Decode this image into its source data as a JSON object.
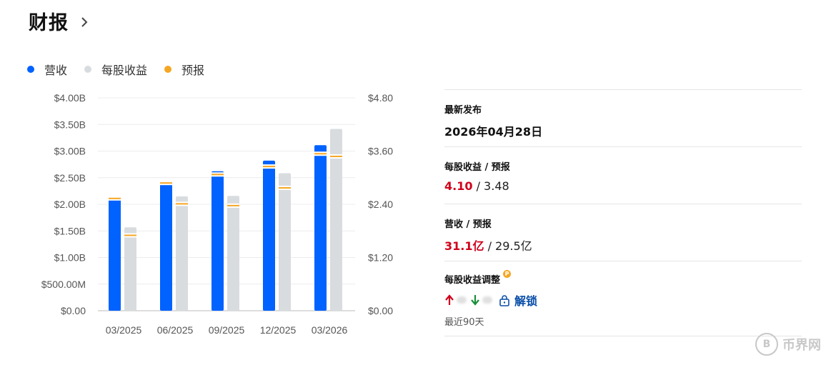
{
  "header": {
    "title": "财报"
  },
  "legend": [
    {
      "label": "营收",
      "color": "#0062ff"
    },
    {
      "label": "每股收益",
      "color": "#d9dcdf"
    },
    {
      "label": "预报",
      "color": "#f5a623"
    }
  ],
  "chart_data": {
    "type": "bar",
    "categories": [
      "03/2025",
      "06/2025",
      "09/2025",
      "12/2025",
      "03/2026"
    ],
    "left_axis": {
      "ticks": [
        "$4.00B",
        "$3.50B",
        "$3.00B",
        "$2.50B",
        "$2.00B",
        "$1.50B",
        "$1.00B",
        "$500.00M",
        "$0.00"
      ],
      "ylim": [
        0,
        4.0
      ],
      "unit": "B"
    },
    "right_axis": {
      "ticks": [
        "$4.80",
        "$3.60",
        "$2.40",
        "$1.20",
        "$0.00"
      ],
      "ylim": [
        0,
        4.8
      ]
    },
    "series": [
      {
        "name": "营收",
        "axis": "left",
        "color": "#0062ff",
        "values": [
          2.14,
          2.4,
          2.62,
          2.82,
          3.11
        ],
        "forecast": [
          2.11,
          2.4,
          2.56,
          2.71,
          2.95
        ]
      },
      {
        "name": "每股收益",
        "axis": "right",
        "color": "#d9dcdf",
        "values": [
          1.88,
          2.58,
          2.59,
          3.1,
          4.1
        ],
        "forecast": [
          1.7,
          2.41,
          2.37,
          2.77,
          3.48
        ]
      }
    ],
    "forecast_color": "#f5a623",
    "grid": true
  },
  "panel": {
    "latest_label": "最新发布",
    "latest_date": "2026年04月28日",
    "eps_label": "每股收益 / 预报",
    "eps_actual": "4.10",
    "eps_sep": " / ",
    "eps_forecast": "3.48",
    "rev_label": "营收 / 预报",
    "rev_actual": "31.1亿",
    "rev_sep": " / ",
    "rev_forecast": "29.5亿",
    "adj_label": "每股收益调整",
    "adj_badge": "P",
    "unlock_label": "解锁",
    "period_label": "最近90天"
  },
  "watermark": {
    "symbol": "B",
    "text": "币界网"
  }
}
